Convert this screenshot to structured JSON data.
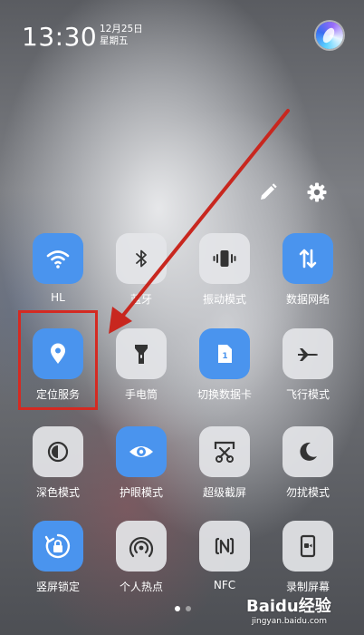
{
  "status_bar": {
    "time": "13:30",
    "date": "12月25日",
    "weekday": "星期五"
  },
  "header_actions": {
    "edit": "pencil-icon",
    "settings": "gear-icon"
  },
  "colors": {
    "tile_on": "#4a94ee",
    "tile_off": "#e4e5e8",
    "annotation_red": "#d42a22"
  },
  "tiles": [
    {
      "label": "HL",
      "icon": "wifi-icon",
      "active": true
    },
    {
      "label": "蓝牙",
      "icon": "bluetooth-icon",
      "active": false
    },
    {
      "label": "振动模式",
      "icon": "vibrate-icon",
      "active": false
    },
    {
      "label": "数据网络",
      "icon": "mobile-data-icon",
      "active": true
    },
    {
      "label": "定位服务",
      "icon": "location-icon",
      "active": true
    },
    {
      "label": "手电筒",
      "icon": "flashlight-icon",
      "active": false
    },
    {
      "label": "切换数据卡",
      "icon": "sim-card-icon",
      "active": true
    },
    {
      "label": "飞行模式",
      "icon": "airplane-icon",
      "active": false
    },
    {
      "label": "深色模式",
      "icon": "dark-mode-icon",
      "active": false
    },
    {
      "label": "护眼模式",
      "icon": "eye-icon",
      "active": true
    },
    {
      "label": "超级截屏",
      "icon": "screenshot-icon",
      "active": false
    },
    {
      "label": "勿扰模式",
      "icon": "moon-icon",
      "active": false
    },
    {
      "label": "竖屏锁定",
      "icon": "rotation-lock-icon",
      "active": true
    },
    {
      "label": "个人热点",
      "icon": "hotspot-icon",
      "active": false
    },
    {
      "label": "NFC",
      "icon": "nfc-icon",
      "active": false
    },
    {
      "label": "录制屏幕",
      "icon": "screen-record-icon",
      "active": false
    }
  ],
  "pager": {
    "pages": 2,
    "current": 1
  },
  "watermark": {
    "brand": "Baidu经验",
    "url": "jingyan.baidu.com"
  }
}
